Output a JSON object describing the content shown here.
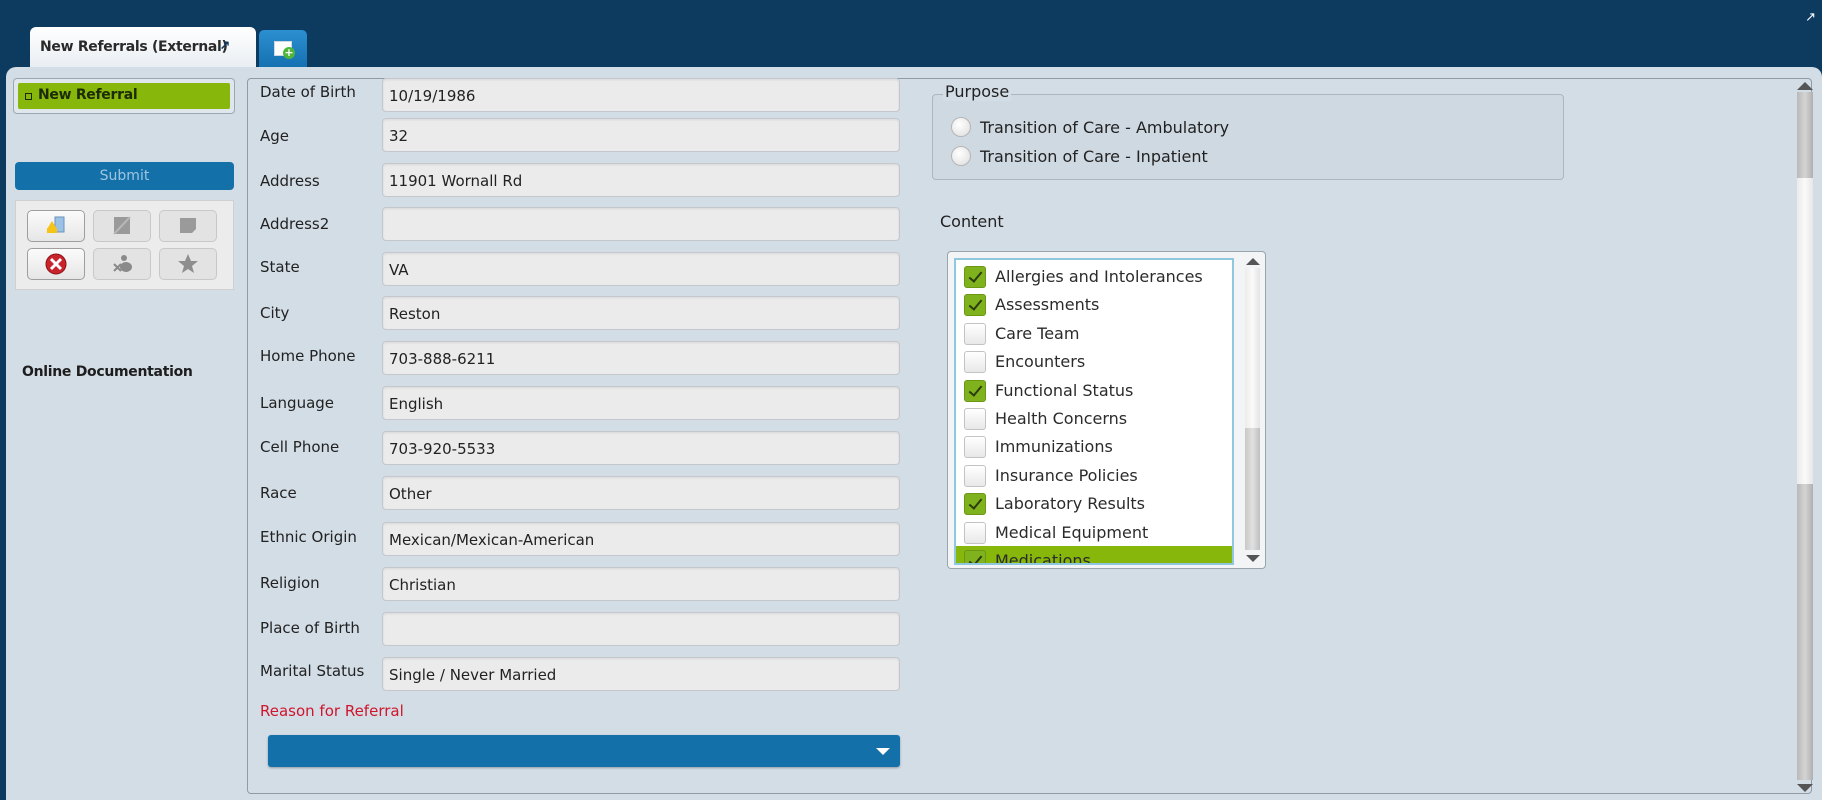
{
  "tabs": [
    {
      "label": "New Referrals (External)",
      "active": true,
      "icon": "pin-icon"
    },
    {
      "label": "",
      "icon": "add-tab-icon"
    }
  ],
  "window": {
    "expand_icon": "expand-icon"
  },
  "sidebar": {
    "nav_items": [
      {
        "label": "New Referral",
        "selected": true
      }
    ],
    "submit_label": "Submit",
    "toolbar_icons": [
      "add-document-icon",
      "edit-icon",
      "note-icon",
      "delete-icon",
      "unassign-icon",
      "favorite-icon"
    ],
    "online_documentation_label": "Online Documentation"
  },
  "form": {
    "fields": [
      {
        "label": "Date of Birth",
        "value": "10/19/1986"
      },
      {
        "label": "Age",
        "value": "32"
      },
      {
        "label": "Address",
        "value": "11901 Wornall Rd"
      },
      {
        "label": "Address2",
        "value": ""
      },
      {
        "label": "State",
        "value": "VA"
      },
      {
        "label": "City",
        "value": "Reston"
      },
      {
        "label": "Home Phone",
        "value": "703-888-6211"
      },
      {
        "label": "Language",
        "value": "English"
      },
      {
        "label": "Cell Phone",
        "value": "703-920-5533"
      },
      {
        "label": "Race",
        "value": "Other"
      },
      {
        "label": "Ethnic Origin",
        "value": "Mexican/Mexican-American"
      },
      {
        "label": "Religion",
        "value": "Christian"
      },
      {
        "label": "Place of Birth",
        "value": ""
      },
      {
        "label": "Marital Status",
        "value": "Single / Never Married"
      }
    ],
    "reason_label": "Reason for Referral",
    "reason_value": "",
    "reason_label_color": "#d0152c"
  },
  "purpose": {
    "legend": "Purpose",
    "options": [
      {
        "label": "Transition of Care - Ambulatory",
        "selected": false
      },
      {
        "label": "Transition of Care - Inpatient",
        "selected": false
      }
    ]
  },
  "content": {
    "label": "Content",
    "items": [
      {
        "label": "Allergies and Intolerances",
        "checked": true
      },
      {
        "label": "Assessments",
        "checked": true
      },
      {
        "label": "Care Team",
        "checked": false
      },
      {
        "label": "Encounters",
        "checked": false
      },
      {
        "label": "Functional Status",
        "checked": true
      },
      {
        "label": "Health Concerns",
        "checked": false
      },
      {
        "label": "Immunizations",
        "checked": false
      },
      {
        "label": "Insurance Policies",
        "checked": false
      },
      {
        "label": "Laboratory Results",
        "checked": true
      },
      {
        "label": "Medical Equipment",
        "checked": false
      },
      {
        "label": "Medications",
        "checked": true,
        "highlighted": true
      }
    ]
  },
  "colors": {
    "accent_green": "#86b70a",
    "primary_blue": "#1470a8",
    "header_navy": "#0d3a5f"
  }
}
